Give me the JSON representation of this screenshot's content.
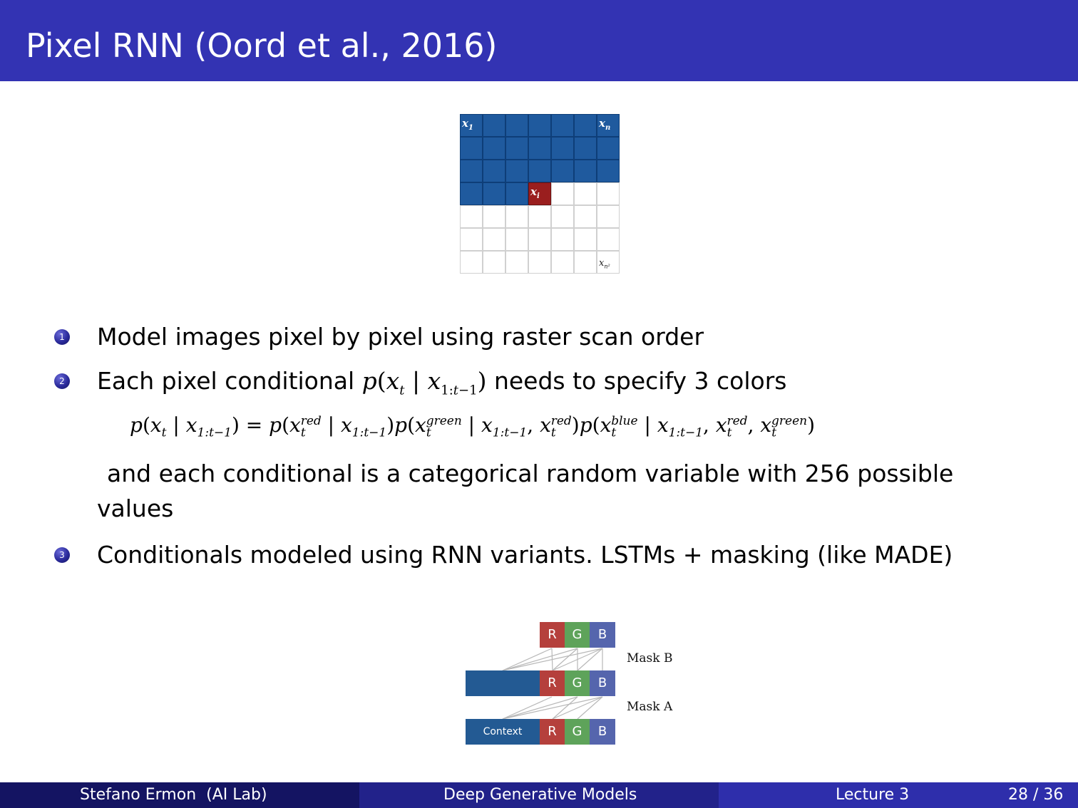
{
  "title": "Pixel RNN (Oord et al., 2016)",
  "grid": {
    "rows": 7,
    "cols": 7,
    "filled_count": 24,
    "current_index": 24,
    "label_first": "x",
    "label_first_sub": "1",
    "label_n": "x",
    "label_n_sub": "n",
    "label_i": "x",
    "label_i_sub": "i",
    "label_last": "x",
    "label_last_sub": "n²"
  },
  "items": [
    {
      "num": "1",
      "text": "Model images pixel by pixel using raster scan order"
    },
    {
      "num": "2",
      "text_before": "Each pixel conditional ",
      "math_inline": "p(x_t | x_{1:t−1})",
      "text_after": " needs to specify 3 colors"
    },
    {
      "num": "3",
      "text": "Conditionals modeled using RNN variants. LSTMs + masking (like MADE)"
    }
  ],
  "equation": "p(x_t | x_{1:t−1}) = p(x_t^{red} | x_{1:t−1}) p(x_t^{green} | x_{1:t−1}, x_t^{red}) p(x_t^{blue} | x_{1:t−1}, x_t^{red}, x_t^{green})",
  "continuation_line1": "and each conditional is a categorical random variable with 256 possible",
  "continuation_line2": "values",
  "diagram": {
    "top_labels": [
      "R",
      "G",
      "B"
    ],
    "middle_labels": [
      "R",
      "G",
      "B"
    ],
    "bottom_context": "Context",
    "bottom_labels": [
      "R",
      "G",
      "B"
    ],
    "mask_b": "Mask B",
    "mask_a": "Mask A",
    "colors": {
      "red": "#b5403c",
      "green": "#5ea35a",
      "blue": "#5565ad",
      "context": "#235a93"
    }
  },
  "footer": {
    "author": "Stefano Ermon  (AI Lab)",
    "course": "Deep Generative Models",
    "lecture": "Lecture 3",
    "page": "28 / 36"
  },
  "colors": {
    "title_bar": "#3333b3",
    "grid_filled": "#1f5a9e",
    "grid_current": "#9a1e1e"
  }
}
